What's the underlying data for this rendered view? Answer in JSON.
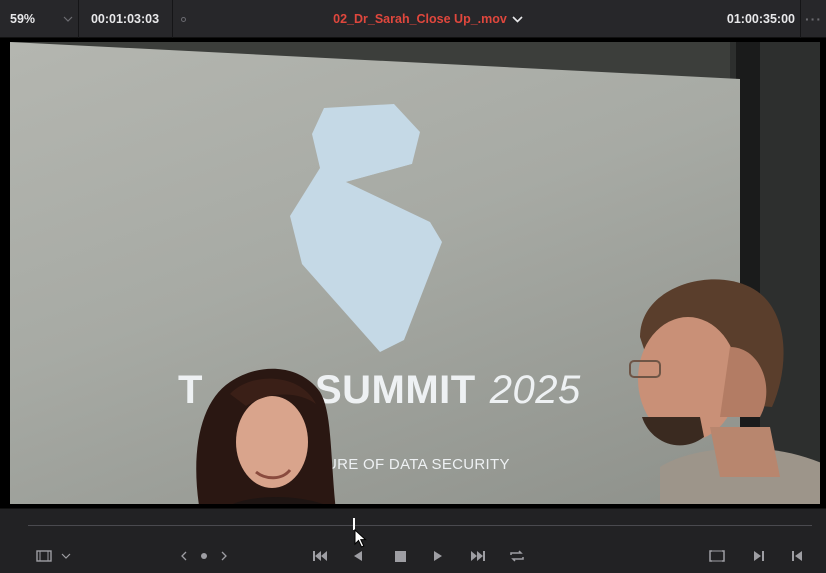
{
  "topbar": {
    "zoom": "59%",
    "source_timecode": "00:01:03:03",
    "clip_name": "02_Dr_Sarah_Close Up_.mov",
    "timeline_timecode": "01:00:35:00"
  },
  "frame": {
    "summit_text": "TECH SUMMIT",
    "summit_visible_left": "T",
    "summit_visible_right": "SUMMIT",
    "summit_year": "2025",
    "tagline": "URE OF DATA SECURITY"
  },
  "transport": {
    "playhead_position": 0.416,
    "icons": [
      "clip-view-icon",
      "chevron-down-icon",
      "prev-icon",
      "marker-dot-icon",
      "next-icon",
      "jump-to-start-icon",
      "play-reverse-icon",
      "stop-icon",
      "play-icon",
      "jump-to-end-icon",
      "loop-icon",
      "match-frame-icon",
      "next-edit-icon",
      "prev-edit-icon"
    ]
  },
  "colors": {
    "clip_name": "#e0473d",
    "bar_bg": "#27272a",
    "icon": "#9e9ea3"
  }
}
